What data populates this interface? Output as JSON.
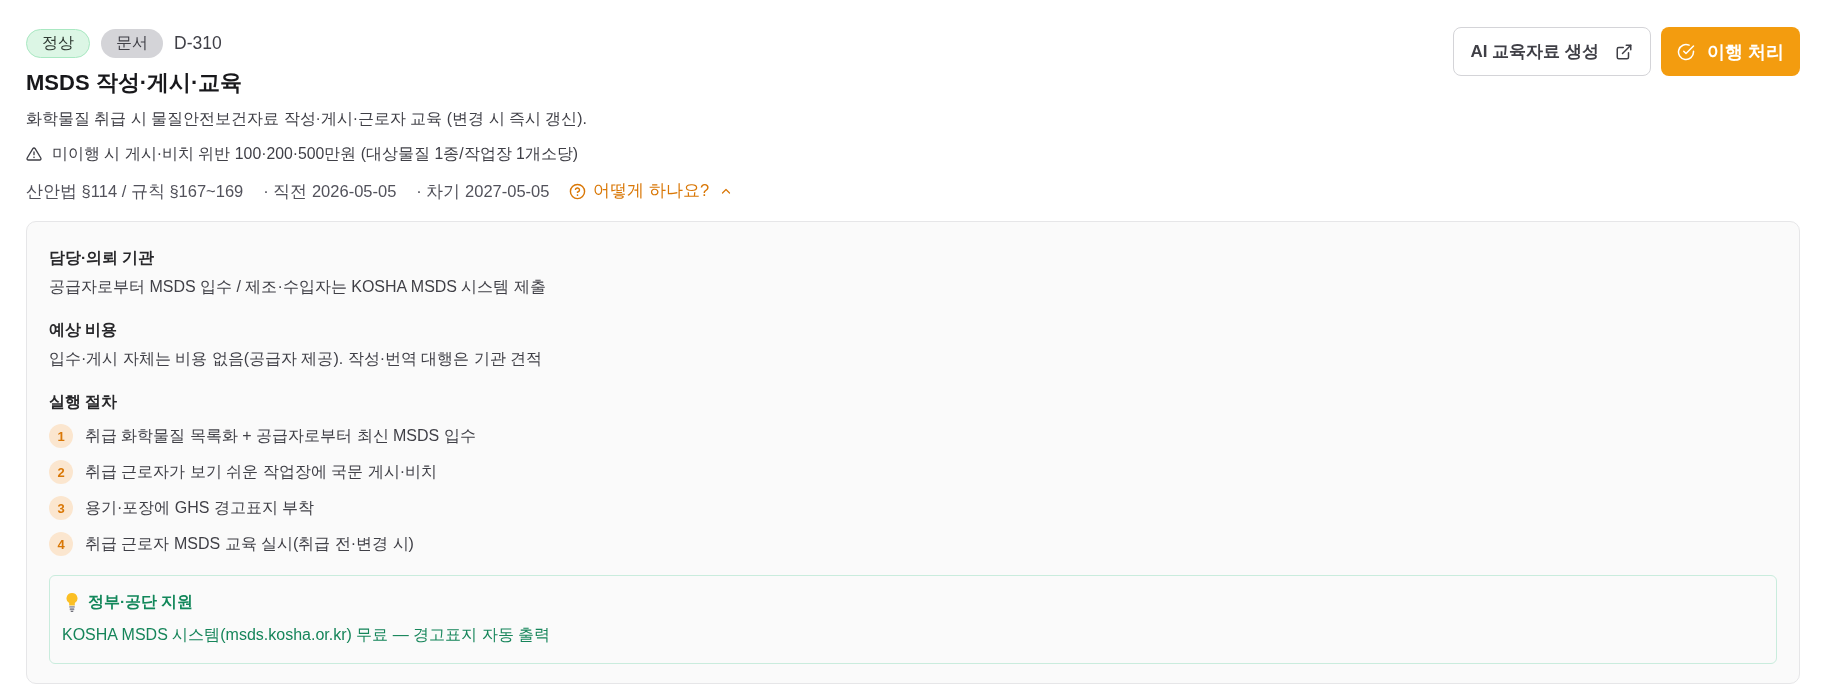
{
  "header": {
    "badges": [
      {
        "label": "정상",
        "kind": "status"
      },
      {
        "label": "문서",
        "kind": "type"
      }
    ],
    "code": "D-310",
    "title": "MSDS 작성·게시·교육",
    "description": "화학물질 취급 시 물질안전보건자료 작성·게시·근로자 교육 (변경 시 즉시 갱신).",
    "warning": "미이행 시 게시·비치 위반 100·200·500만원 (대상물질 1종/작업장 1개소당)",
    "meta": {
      "reference": "산안법 §114 / 규칙 §167~169",
      "previous": "· 직전 2026-05-05",
      "next": "· 차기 2027-05-05"
    },
    "help_link": {
      "label": "어떻게 하나요?",
      "expanded": true
    }
  },
  "actions": [
    {
      "label": "AI 교육자료 생성",
      "kind": "external"
    },
    {
      "label": "이행 처리",
      "kind": "primary"
    }
  ],
  "details": {
    "sections": [
      {
        "heading": "담당·의뢰 기관",
        "text": "공급자로부터 MSDS 입수 / 제조·수입자는 KOSHA MSDS 시스템 제출"
      },
      {
        "heading": "예상 비용",
        "text": "입수·게시 자체는 비용 없음(공급자 제공). 작성·번역 대행은 기관 견적"
      }
    ],
    "steps": {
      "heading": "실행 절차",
      "items": [
        {
          "number": "1",
          "text": "취급 화학물질 목록화 + 공급자로부터 최신 MSDS 입수"
        },
        {
          "number": "2",
          "text": "취급 근로자가 보기 쉬운 작업장에 국문 게시·비치"
        },
        {
          "number": "3",
          "text": "용기·포장에 GHS 경고표지 부착"
        },
        {
          "number": "4",
          "text": "취급 근로자 MSDS 교육 실시(취급 전·변경 시)"
        }
      ]
    },
    "support": {
      "title": "정부·공단 지원",
      "text": "KOSHA MSDS 시스템(msds.kosha.or.kr) 무료 — 경고표지 자동 출력"
    }
  }
}
